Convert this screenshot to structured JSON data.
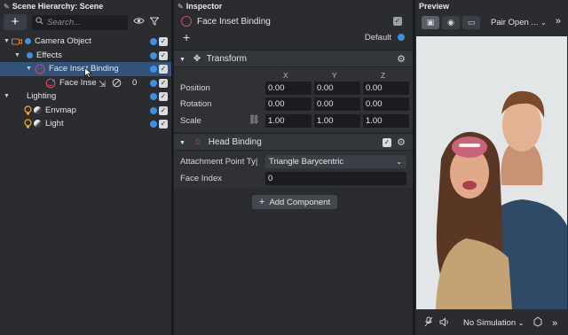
{
  "hierarchy": {
    "title": "Scene Hierarchy: Scene",
    "add_label": "+",
    "search_placeholder": "Search...",
    "items": [
      {
        "label": "Camera Object",
        "depth": 0,
        "expanded": true,
        "icon": "camera-icon"
      },
      {
        "label": "Effects",
        "depth": 1,
        "expanded": true,
        "icon": "none"
      },
      {
        "label": "Face Inset Binding",
        "depth": 2,
        "expanded": true,
        "icon": "face-binding-icon",
        "selected": true
      },
      {
        "label": "Face Inse",
        "depth": 3,
        "expanded": false,
        "icon": "face-inset-icon"
      },
      {
        "label": "Lighting",
        "depth": 0,
        "expanded": true,
        "icon": "none"
      },
      {
        "label": "Envmap",
        "depth": 1,
        "expanded": false,
        "icon": "light-icon"
      },
      {
        "label": "Light",
        "depth": 1,
        "expanded": false,
        "icon": "light-icon"
      }
    ],
    "inline_value": "0"
  },
  "inspector": {
    "title": "Inspector",
    "object_name": "Face Inset Binding",
    "layer_label": "Default",
    "transform": {
      "title": "Transform",
      "axes": [
        "X",
        "Y",
        "Z"
      ],
      "rows": [
        {
          "label": "Position",
          "values": [
            "0.00",
            "0.00",
            "0.00"
          ]
        },
        {
          "label": "Rotation",
          "values": [
            "0.00",
            "0.00",
            "0.00"
          ]
        },
        {
          "label": "Scale",
          "values": [
            "1.00",
            "1.00",
            "1.00"
          ]
        }
      ]
    },
    "head_binding": {
      "title": "Head Binding",
      "attachment_label": "Attachment Point Ty|",
      "attachment_value": "Triangle Barycentric",
      "face_index_label": "Face Index",
      "face_index_value": "0"
    },
    "add_component_label": "Add Component"
  },
  "preview": {
    "title": "Preview",
    "pair_label": "Pair Open ...",
    "simulation_label": "No Simulation"
  },
  "colors": {
    "accent": "#3d8fe0",
    "selection": "#34537a",
    "panel": "#2a2c30"
  }
}
